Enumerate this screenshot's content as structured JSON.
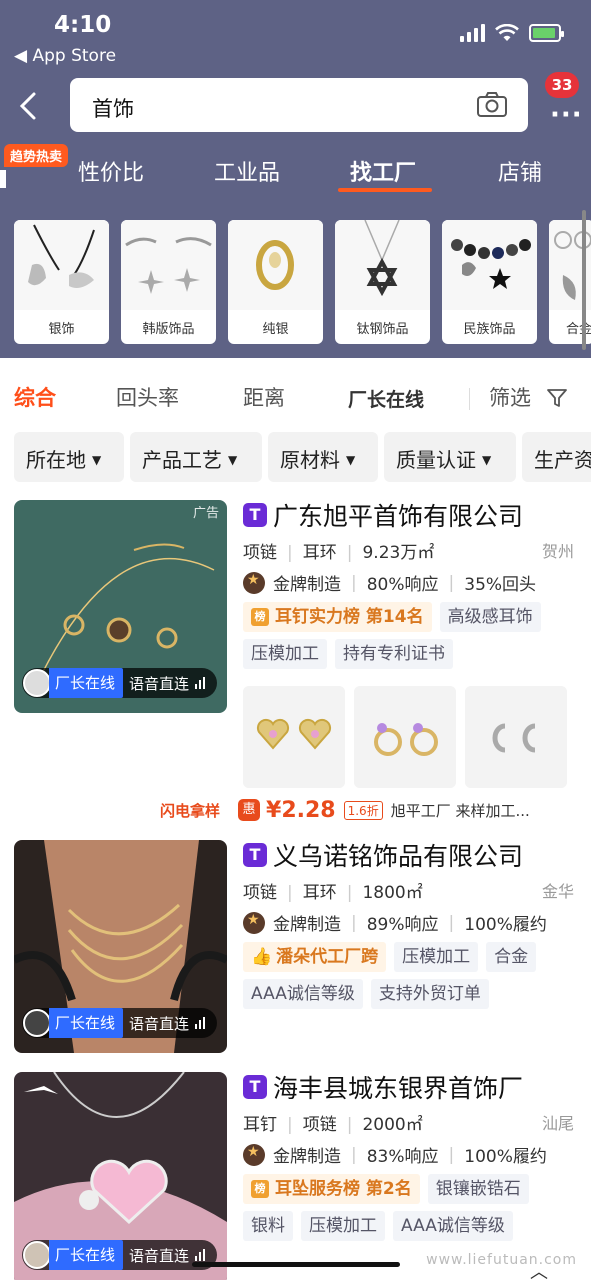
{
  "status": {
    "time": "4:10",
    "back_app": "◀ App Store"
  },
  "search": {
    "query": "首饰",
    "badge_count": "33"
  },
  "hot_tag": "趋势热卖",
  "tabs": [
    "性价比",
    "工业品",
    "找工厂",
    "店铺"
  ],
  "active_tab": "找工厂",
  "categories": [
    "银饰",
    "韩版饰品",
    "纯银",
    "钛钢饰品",
    "民族饰品",
    "合金"
  ],
  "sort": {
    "items": [
      "综合",
      "回头率",
      "距离",
      "厂长在线"
    ],
    "filter": "筛选"
  },
  "filters": [
    "所在地",
    "产品工艺",
    "原材料",
    "质量认证",
    "生产资"
  ],
  "listing": [
    {
      "name": "广东旭平首饰有限公司",
      "ad": "广告",
      "meta": [
        "项链",
        "耳环",
        "9.23万㎡"
      ],
      "city": "贺州",
      "level": "金牌制造",
      "response": "80%响应",
      "third": "35%回头",
      "tags_row1": [
        "耳钉实力榜 第14名",
        "高级感耳饰"
      ],
      "tags_row2": [
        "压模加工",
        "持有专利证书"
      ],
      "flash": "闪电拿样",
      "price": "¥2.28",
      "discount": "1.6折",
      "seller": "旭平工厂  来样加工..."
    },
    {
      "name": "义乌诺铭饰品有限公司",
      "meta": [
        "项链",
        "耳环",
        "1800㎡"
      ],
      "city": "金华",
      "level": "金牌制造",
      "response": "89%响应",
      "third": "100%履约",
      "tags_row1": [
        "潘朵代工厂跨",
        "压模加工",
        "合金"
      ],
      "tags_row2": [
        "AAA诚信等级",
        "支持外贸订单"
      ]
    },
    {
      "name": "海丰县城东银界首饰厂",
      "meta": [
        "耳钉",
        "项链",
        "2000㎡"
      ],
      "city": "汕尾",
      "level": "金牌制造",
      "response": "83%响应",
      "third": "100%履约",
      "tags_row1": [
        "耳坠服务榜 第2名",
        "银镶嵌锆石"
      ],
      "tags_row2": [
        "银料",
        "压模加工",
        "AAA诚信等级"
      ]
    }
  ],
  "owner_badge": {
    "online": "厂长在线",
    "voice": "语音直连"
  },
  "watermark": "www.liefutuan.com",
  "colors": {
    "header": "#5e6285",
    "accent": "#ff4f1a",
    "shop_icon": "#6a2bd6"
  }
}
